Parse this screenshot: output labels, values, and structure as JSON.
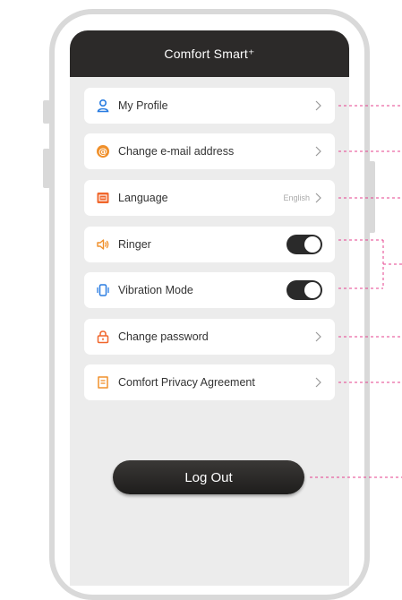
{
  "app": {
    "title": "Comfort Smart⁺"
  },
  "menu": [
    {
      "label": "My Profile",
      "icon": "user-icon",
      "color": "#2a7de1"
    },
    {
      "label": "Change e-mail address",
      "icon": "at-sign-icon",
      "color": "#f0902b"
    },
    {
      "label": "Language",
      "icon": "language-icon",
      "color": "#f0662b",
      "value": "English"
    },
    {
      "label": "Ringer",
      "icon": "speaker-icon",
      "color": "#f0902b",
      "toggle": "on"
    },
    {
      "label": "Vibration Mode",
      "icon": "vibration-phone-icon",
      "color": "#2a7de1",
      "toggle": "on"
    },
    {
      "label": "Change password",
      "icon": "lock-icon",
      "color": "#f0662b"
    },
    {
      "label": "Comfort Privacy Agreement",
      "icon": "document-icon",
      "color": "#f0902b"
    }
  ],
  "logout": {
    "label": "Log Out"
  },
  "annotation_color": "#e5418e"
}
